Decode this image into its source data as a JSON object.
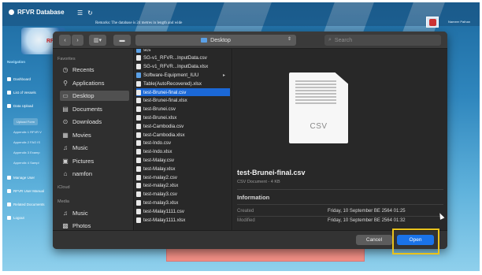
{
  "app": {
    "title": "RFVR Database",
    "remarks": "Remarks: The database is 24 metres in length and wide",
    "logo_text": "RFVR",
    "user_name": "Nameer Pathan",
    "sidebar": {
      "section": "Navigation",
      "items": [
        {
          "label": "Dashboard"
        },
        {
          "label": "List of Vessels"
        },
        {
          "label": "Data Upload"
        }
      ],
      "sub_items": [
        {
          "label": "Upload Form"
        },
        {
          "label": "Appendix 1 RFVR V"
        },
        {
          "label": "Appendix 2 FAO IS"
        },
        {
          "label": "Appendix 3 Examp"
        },
        {
          "label": "Appendix 4 Sampl"
        }
      ],
      "items_bottom": [
        {
          "label": "Manage User"
        },
        {
          "label": "RFVR User Manual"
        },
        {
          "label": "Related Documents"
        },
        {
          "label": "Logout"
        }
      ]
    }
  },
  "dialog": {
    "location": "Desktop",
    "search_placeholder": "Search",
    "favorites_head": "Favorites",
    "icloud_head": "iCloud",
    "media_head": "Media",
    "favorites": [
      {
        "label": "Recents",
        "icon": "clock-icon",
        "glyph": "◷"
      },
      {
        "label": "Applications",
        "icon": "applications-icon",
        "glyph": "⚲"
      },
      {
        "label": "Desktop",
        "icon": "desktop-icon",
        "glyph": "▭",
        "selected": true
      },
      {
        "label": "Documents",
        "icon": "documents-icon",
        "glyph": "▤"
      },
      {
        "label": "Downloads",
        "icon": "downloads-icon",
        "glyph": "⊙"
      },
      {
        "label": "Movies",
        "icon": "movies-icon",
        "glyph": "▦"
      },
      {
        "label": "Music",
        "icon": "music-icon",
        "glyph": "♫"
      },
      {
        "label": "Pictures",
        "icon": "pictures-icon",
        "glyph": "▣"
      },
      {
        "label": "namfon",
        "icon": "home-icon",
        "glyph": "⌂"
      }
    ],
    "media": [
      {
        "label": "Music",
        "icon": "music-icon",
        "glyph": "♫"
      },
      {
        "label": "Photos",
        "icon": "photos-icon",
        "glyph": "▩"
      }
    ],
    "files": [
      {
        "name": "scs",
        "folder": true
      },
      {
        "name": "SG-v1_RFVR...InputData.csv"
      },
      {
        "name": "SG-v1_RFVR...InputData.xlsx"
      },
      {
        "name": "Software-Equipment_IUU",
        "folder": true
      },
      {
        "name": "Table(AutoRecovered).xlsx"
      },
      {
        "name": "test-Brunei-final.csv",
        "selected": true
      },
      {
        "name": "test-Brunei-final.xlsx"
      },
      {
        "name": "test-Brunei.csv"
      },
      {
        "name": "test-Brunei.xlsx"
      },
      {
        "name": "test-Cambodia.csv"
      },
      {
        "name": "test-Cambodia.xlsx"
      },
      {
        "name": "test-Indo.csv"
      },
      {
        "name": "test-Indo.xlsx"
      },
      {
        "name": "test-Malay.csv"
      },
      {
        "name": "test-Malay.xlsx"
      },
      {
        "name": "test-malay2.csv"
      },
      {
        "name": "test-malay2.xlsx"
      },
      {
        "name": "test-malay3.csv"
      },
      {
        "name": "test-malay3.xlsx"
      },
      {
        "name": "test-Malay1111.csv"
      },
      {
        "name": "test-Malay1111.xlsx"
      }
    ],
    "preview": {
      "ext": "CSV",
      "file_name": "test-Brunei-final.csv",
      "kind": "CSV Document - 4 KB",
      "info_heading": "Information",
      "created_label": "Created",
      "created_value": "Friday, 10 September BE 2564 01:25",
      "modified_label": "Modified",
      "modified_value": "Friday, 10 September BE 2564 01:32"
    },
    "cancel_label": "Cancel",
    "open_label": "Open"
  }
}
